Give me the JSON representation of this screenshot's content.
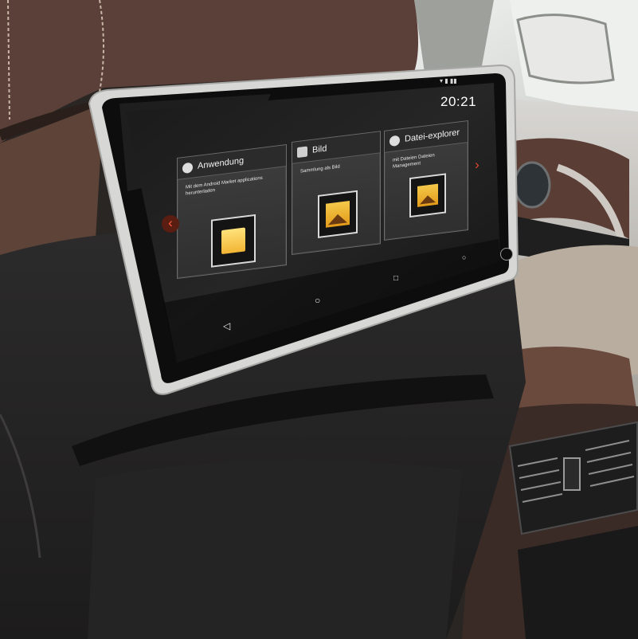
{
  "screen": {
    "clock": "20:21",
    "status_icons": "▾ ▮ ▮▮",
    "cards": [
      {
        "title": "Anwendung",
        "icon": "android-app-icon",
        "description": "Mit dem Android Market applications herunterladen",
        "thumb": "shopping-bag-icon"
      },
      {
        "title": "Bild",
        "icon": "image-icon",
        "description": "Sammlung als Bild",
        "thumb": "picture-icon"
      },
      {
        "title": "Datei-explorer",
        "icon": "folder-icon",
        "description": "mit Dateien Dateien Management",
        "thumb": "picture-icon"
      }
    ],
    "nav": {
      "back": "◁",
      "home": "○",
      "recent": "□",
      "home_small": "○",
      "dot": "●"
    },
    "arrows": {
      "left": "‹",
      "right": "›"
    },
    "accent_color": "#e2472c"
  }
}
